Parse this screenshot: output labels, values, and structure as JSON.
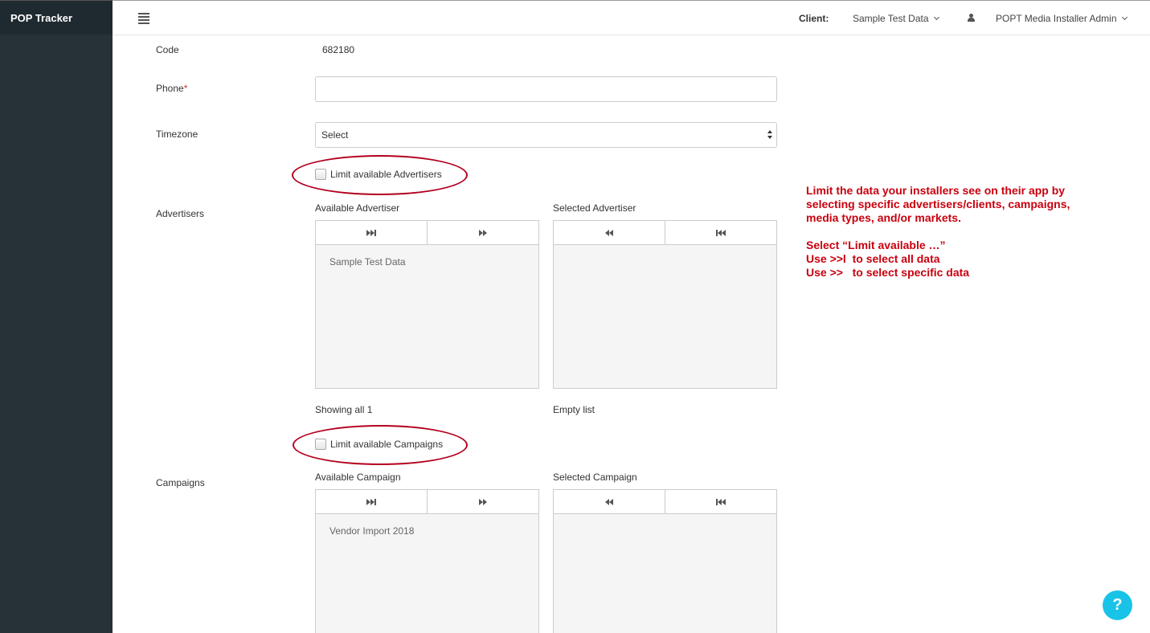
{
  "app": {
    "title": "POP Tracker"
  },
  "header": {
    "client_label": "Client:",
    "client_value": "Sample Test Data",
    "user_name": "POPT Media Installer Admin"
  },
  "form": {
    "code": {
      "label": "Code",
      "value": "682180"
    },
    "phone": {
      "label": "Phone",
      "required_mark": "*",
      "value": ""
    },
    "timezone": {
      "label": "Timezone",
      "selected": "Select"
    },
    "advertisers": {
      "limit_label": "Limit available Advertisers",
      "limit_checked": false,
      "label": "Advertisers",
      "available_heading": "Available Advertiser",
      "selected_heading": "Selected Advertiser",
      "available_items": [
        "Sample Test Data"
      ],
      "selected_items": [],
      "available_status": "Showing all 1",
      "selected_status": "Empty list"
    },
    "campaigns": {
      "limit_label": "Limit available Campaigns",
      "limit_checked": false,
      "label": "Campaigns",
      "available_heading": "Available Campaign",
      "selected_heading": "Selected Campaign",
      "available_items": [
        "Vendor Import 2018"
      ],
      "selected_items": []
    }
  },
  "annotation": {
    "color": "#c8000e",
    "lines": [
      "Limit the data your installers see on their app by",
      "selecting specific advertisers/clients, campaigns,",
      "media types, and/or markets.",
      "",
      "Select “Limit available …”",
      "Use >>l  to select all data",
      "Use >>   to select specific data"
    ]
  },
  "help": {
    "label": "?"
  },
  "colors": {
    "sidebar": "#263238",
    "help_button": "#19c3e8",
    "oval": "#b3001e"
  }
}
